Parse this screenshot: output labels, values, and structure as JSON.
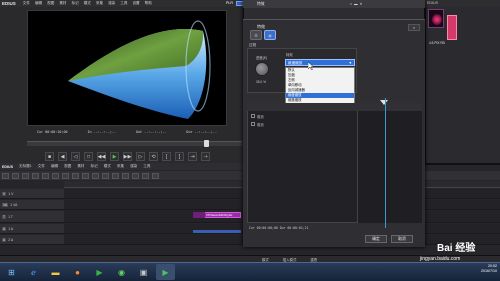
{
  "player": {
    "logo": "EDIUS",
    "menu": [
      "文件",
      "编辑",
      "视图",
      "素材",
      "标记",
      "模式",
      "采集",
      "渲染",
      "工具",
      "设置",
      "帮助"
    ],
    "badge": "PLR",
    "timecodes": {
      "cur": "Cur 00:00:10;06",
      "in": "In --:--:--;--",
      "out": "Out --:--:--;--",
      "dur": "Dur --:--:--;--"
    }
  },
  "timeline": {
    "logo": "EDIUS",
    "project": "无标题1",
    "tracks": [
      {
        "label": "V",
        "name": "1 V"
      },
      {
        "label": "VA",
        "name": "1 VA"
      },
      {
        "label": "T",
        "name": "1 T"
      },
      {
        "label": "A",
        "name": "1 A"
      },
      {
        "label": "A",
        "name": "2 A"
      }
    ],
    "clip_label": "3TPakoloS2D2Q1H"
  },
  "bin": {
    "title": "EDIUS",
    "thumb_label": "4:3 PIX RD"
  },
  "effects": {
    "window_title": "特效",
    "titlebar_icons": [
      "□",
      "▬",
      "✕"
    ],
    "dialog_title": "特效",
    "close": "×",
    "section": "过程",
    "knob_label": "进度(E)",
    "knob_value": "35.0 %",
    "mode_label": "特效",
    "mode_value": "维度缩放",
    "dropdown": [
      "默认",
      "压缩",
      "左侧",
      "单向移动",
      "反向减速器",
      "维度缩放",
      "维度缩放",
      "逐步"
    ],
    "dropdown_selected_index": 5,
    "rows": [
      {
        "label": "卷页",
        "checked": true
      },
      {
        "label": "卷页",
        "checked": true
      }
    ],
    "timecode": "Cur 00:00:00;00  Dur 00:00:01;21",
    "ok": "确定",
    "cancel": "取消"
  },
  "statusbar": [
    "模式",
    "插入模式",
    "重叠"
  ],
  "taskbar": {
    "apps": [
      "start",
      "ie",
      "folder",
      "firefox",
      "edius",
      "360",
      "media",
      "app"
    ],
    "time": "20:52",
    "date": "2016/7/10"
  },
  "watermark": {
    "text": "Bai 经验",
    "url": "jingyan.baidu.com"
  },
  "colors": {
    "accent": "#2f6fd8",
    "clip": "#9b2ea8",
    "play": "#47d04a"
  }
}
